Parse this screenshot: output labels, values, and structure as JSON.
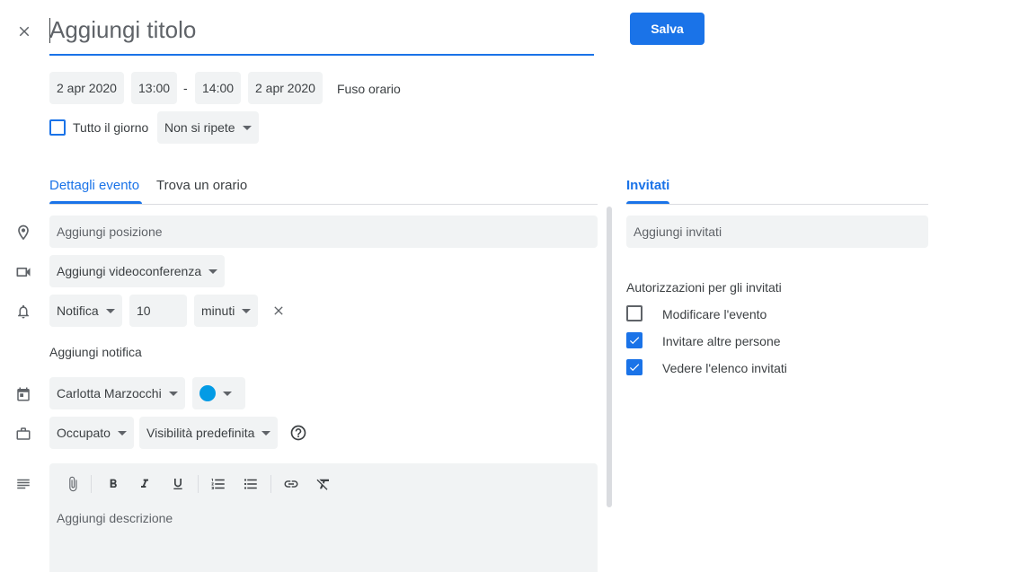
{
  "title": {
    "placeholder": "Aggiungi titolo"
  },
  "save_label": "Salva",
  "datetime": {
    "start_date": "2 apr 2020",
    "start_time": "13:00",
    "separator": "-",
    "end_time": "14:00",
    "end_date": "2 apr 2020",
    "timezone_label": "Fuso orario"
  },
  "all_day_label": "Tutto il giorno",
  "repeat_label": "Non si ripete",
  "tabs": [
    {
      "label": "Dettagli evento",
      "active": true
    },
    {
      "label": "Trova un orario",
      "active": false
    }
  ],
  "location_placeholder": "Aggiungi posizione",
  "videoconf_label": "Aggiungi videoconferenza",
  "notification": {
    "type": "Notifica",
    "value": "10",
    "unit": "minuti",
    "add_label": "Aggiungi notifica"
  },
  "calendar": {
    "owner": "Carlotta Marzocchi",
    "color": "#039be5"
  },
  "status_label": "Occupato",
  "visibility_label": "Visibilità predefinita",
  "description_placeholder": "Aggiungi descrizione",
  "guests": {
    "tab_label": "Invitati",
    "placeholder": "Aggiungi invitati",
    "permissions_title": "Autorizzazioni per gli invitati",
    "permissions": [
      {
        "label": "Modificare l'evento",
        "checked": false
      },
      {
        "label": "Invitare altre persone",
        "checked": true
      },
      {
        "label": "Vedere l'elenco invitati",
        "checked": true
      }
    ]
  },
  "colors": {
    "accent": "#1a73e8",
    "field_bg": "#f1f3f4",
    "text": "#3c4043"
  }
}
